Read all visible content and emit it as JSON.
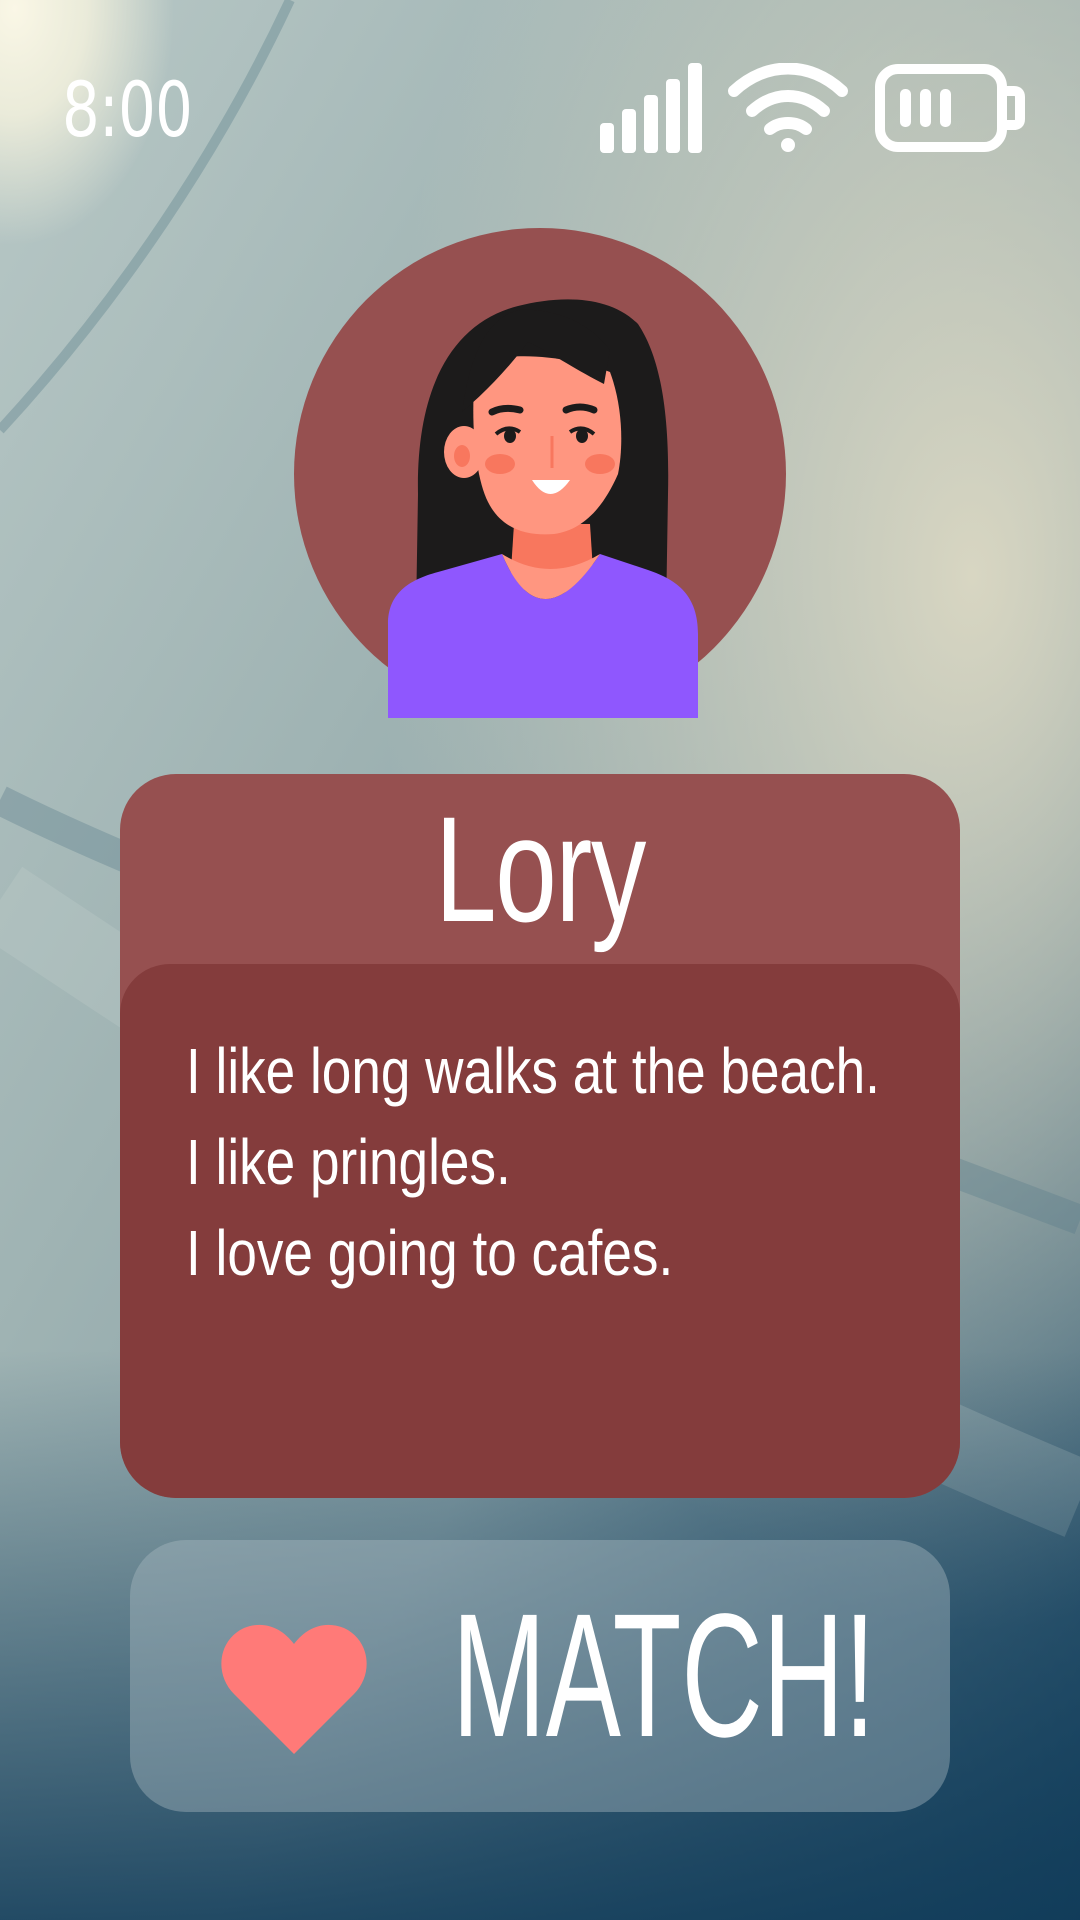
{
  "status_bar": {
    "time": "8:00",
    "icons": [
      "cellular-signal-icon",
      "wifi-icon",
      "battery-icon"
    ]
  },
  "profile": {
    "avatar_icon": "woman-avatar-illustration",
    "name": "Lory",
    "bio_lines": [
      "I like long walks at the beach.",
      "I like pringles.",
      "I love going to cafes."
    ]
  },
  "match_button": {
    "label": "MATCH!",
    "icon": "heart-icon"
  },
  "colors": {
    "card_header": "#965050",
    "card_body": "#843c3c",
    "avatar_circle": "#965050",
    "heart": "#ff7a78",
    "shirt": "#8f57fe",
    "text": "#ffffff"
  }
}
